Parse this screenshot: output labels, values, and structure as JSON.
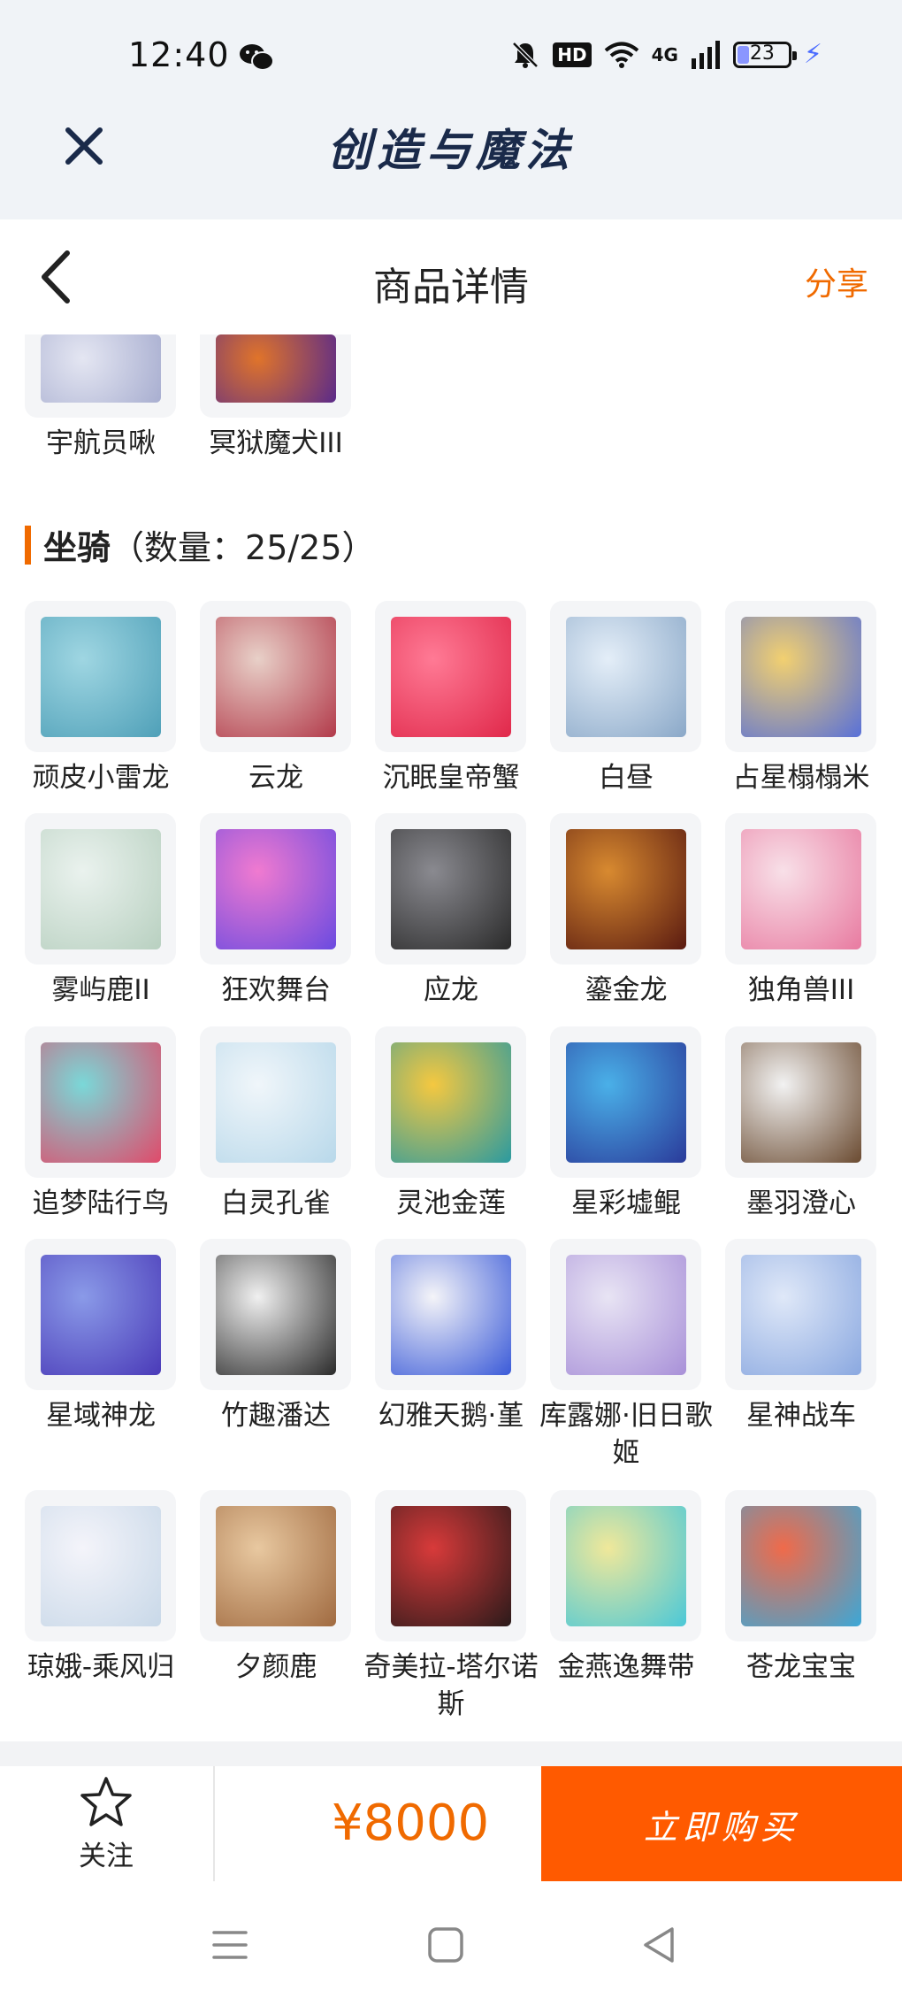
{
  "status_bar": {
    "time": "12:40",
    "network": "4G",
    "battery": "23",
    "battery_level": 0.23
  },
  "app_header": {
    "title": "创造与魔法"
  },
  "nav": {
    "title": "商品详情",
    "share": "分享"
  },
  "top_items": [
    {
      "name": "宇航员啾",
      "colors": [
        "#e4e6f2",
        "#a8aed0"
      ]
    },
    {
      "name": "冥狱魔犬III",
      "colors": [
        "#e0742a",
        "#5a2a8a"
      ]
    }
  ],
  "section": {
    "title": "坐骑",
    "count": "（数量：25/25）"
  },
  "mounts": [
    {
      "name": "顽皮小雷龙",
      "colors": [
        "#9fd6e2",
        "#4fa0b8"
      ]
    },
    {
      "name": "云龙",
      "colors": [
        "#e8d0c8",
        "#b23a4a"
      ]
    },
    {
      "name": "沉眠皇帝蟹",
      "colors": [
        "#ff7a95",
        "#e0284a"
      ]
    },
    {
      "name": "白昼",
      "colors": [
        "#e4eef8",
        "#8aa8c8"
      ]
    },
    {
      "name": "占星榻榻米",
      "colors": [
        "#f2d070",
        "#5870d8"
      ]
    },
    {
      "name": "雾屿鹿II",
      "colors": [
        "#eaf2ee",
        "#b8d0c0"
      ]
    },
    {
      "name": "狂欢舞台",
      "colors": [
        "#f07ad0",
        "#6a4ae0"
      ]
    },
    {
      "name": "应龙",
      "colors": [
        "#8a8a90",
        "#2a2a2a"
      ]
    },
    {
      "name": "鎏金龙",
      "colors": [
        "#d88a30",
        "#5a1a10"
      ]
    },
    {
      "name": "独角兽III",
      "colors": [
        "#f8e0e8",
        "#e87aa0"
      ]
    },
    {
      "name": "追梦陆行鸟",
      "colors": [
        "#7ad8d8",
        "#e04a6a"
      ]
    },
    {
      "name": "白灵孔雀",
      "colors": [
        "#f0f6fa",
        "#b8d8ea"
      ]
    },
    {
      "name": "灵池金莲",
      "colors": [
        "#f5c840",
        "#2a9aa0"
      ]
    },
    {
      "name": "星彩墟鲲",
      "colors": [
        "#4ab0e8",
        "#2a3a9a"
      ]
    },
    {
      "name": "墨羽澄心",
      "colors": [
        "#f2f2f2",
        "#6a4a30"
      ]
    },
    {
      "name": "星域神龙",
      "colors": [
        "#8a9ae8",
        "#4a3ab8"
      ]
    },
    {
      "name": "竹趣潘达",
      "colors": [
        "#f0f0f0",
        "#2a2a2a"
      ]
    },
    {
      "name": "幻雅天鹅·堇",
      "colors": [
        "#f4f4f8",
        "#3a5ad8"
      ]
    },
    {
      "name": "库露娜·旧日歌姬",
      "colors": [
        "#e8e4f4",
        "#a890d8"
      ]
    },
    {
      "name": "星神战车",
      "colors": [
        "#dfe8f8",
        "#8aa8e0"
      ]
    },
    {
      "name": "琼娥-乘风归",
      "colors": [
        "#f4f4fa",
        "#c8d8e8"
      ]
    },
    {
      "name": "夕颜鹿",
      "colors": [
        "#e8c8a0",
        "#a06a40"
      ]
    },
    {
      "name": "奇美拉-塔尔诺斯",
      "colors": [
        "#d83a3a",
        "#2a1a1a"
      ]
    },
    {
      "name": "金燕逸舞带",
      "colors": [
        "#f0e89a",
        "#4ac8d8"
      ]
    },
    {
      "name": "苍龙宝宝",
      "colors": [
        "#f06a4a",
        "#3aa8d8"
      ]
    }
  ],
  "bottom_bar": {
    "follow": "关注",
    "price": "¥8000",
    "buy": "立即购买"
  },
  "accent_color": "#f06a00",
  "buy_color": "#ff5a00"
}
